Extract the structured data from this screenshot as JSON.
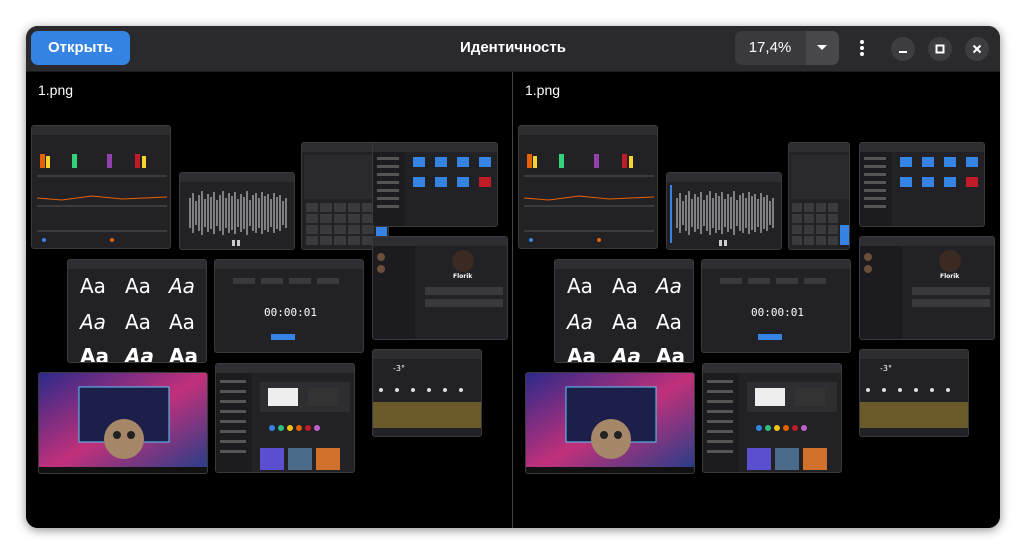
{
  "header": {
    "open_label": "Открыть",
    "title": "Идентичность",
    "zoom": "17,4%"
  },
  "icons": {
    "zoom_dropdown": "chevron-down-icon",
    "menu": "kebab-menu-icon",
    "minimize": "minimize-icon",
    "maximize": "maximize-icon",
    "close": "close-icon"
  },
  "panes": [
    {
      "filename": "1.png"
    },
    {
      "filename": "1.png"
    }
  ],
  "thumbnail": {
    "font_sample": "Aa",
    "timer": "00:00:01",
    "weather_temp": "-3°",
    "profile_name": "Florik"
  },
  "colors": {
    "accent": "#3584e4",
    "header": "#2a2a2e",
    "canvas": "#000000"
  }
}
